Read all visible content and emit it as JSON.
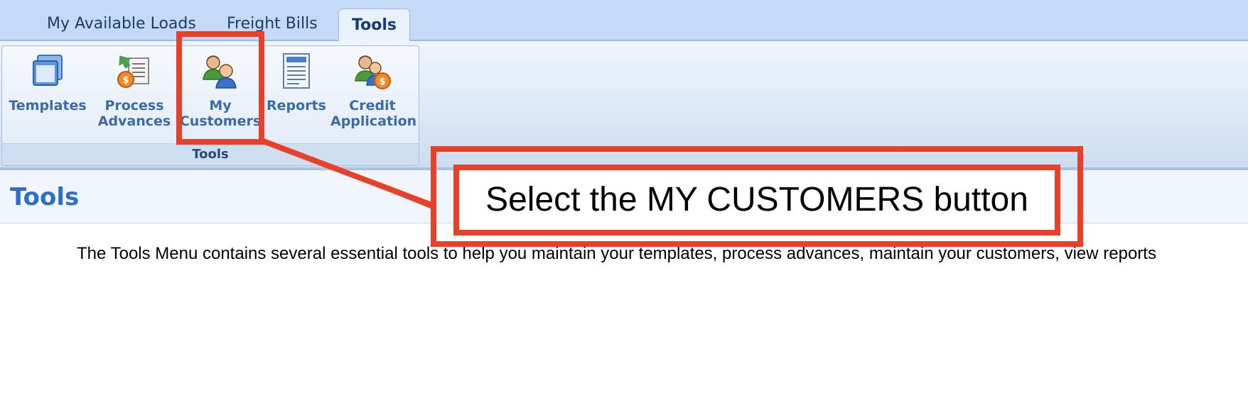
{
  "tabs": [
    {
      "label": "My Available Loads"
    },
    {
      "label": "Freight Bills"
    },
    {
      "label": "Tools",
      "active": true
    }
  ],
  "ribbon": {
    "group_label": "Tools",
    "buttons": [
      {
        "label": "Templates",
        "icon": "templates-icon"
      },
      {
        "label": "Process Advances",
        "icon": "process-advances-icon"
      },
      {
        "label": "My Customers",
        "icon": "my-customers-icon"
      },
      {
        "label": "Reports",
        "icon": "reports-icon"
      },
      {
        "label": "Credit Application",
        "icon": "credit-application-icon"
      }
    ]
  },
  "page": {
    "title": "Tools",
    "intro": "The Tools Menu contains several essential tools to help you maintain your templates, process advances, maintain your customers, view reports"
  },
  "callout": {
    "text": "Select the MY CUSTOMERS button"
  },
  "colors": {
    "accent": "#e8412a",
    "tab_bar": "#c5daf7",
    "title": "#2d6fc4",
    "ribbon_label": "#3b6aa8"
  }
}
